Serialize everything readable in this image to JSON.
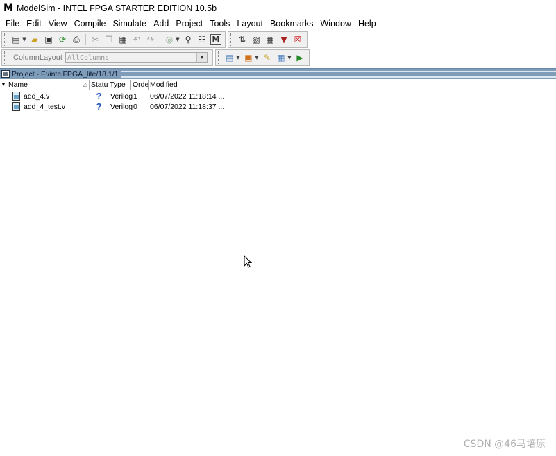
{
  "window": {
    "title": "ModelSim - INTEL FPGA STARTER EDITION 10.5b"
  },
  "menu": [
    "File",
    "Edit",
    "View",
    "Compile",
    "Simulate",
    "Add",
    "Project",
    "Tools",
    "Layout",
    "Bookmarks",
    "Window",
    "Help"
  ],
  "toolbar": {
    "column_layout_label": "ColumnLayout",
    "column_layout_value": "AllColumns"
  },
  "project_pane": {
    "title": "Project - F:/intelFPGA_lite/18.1/1",
    "columns": [
      "Name",
      "Status",
      "Type",
      "Order",
      "Modified"
    ],
    "files": [
      {
        "name": "add_4.v",
        "status_icon": "?",
        "type": "Verilog",
        "order": "1",
        "modified": "06/07/2022 11:18:14 ..."
      },
      {
        "name": "add_4_test.v",
        "status_icon": "?",
        "type": "Verilog",
        "order": "0",
        "modified": "06/07/2022 11:18:37 ..."
      }
    ]
  },
  "watermark": "CSDN @46马培原",
  "colors": {
    "pane_header": "#7f9db9",
    "status_icon": "#1f4fbf"
  }
}
